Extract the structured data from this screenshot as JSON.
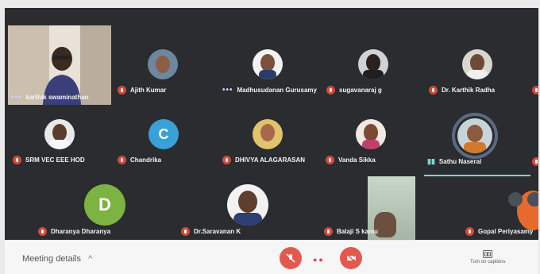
{
  "participants": [
    {
      "name": "karthik swaminathan",
      "row": 1
    },
    {
      "name": "Ajith Kumar",
      "row": 1
    },
    {
      "name": "Madhusudanan Gurusamy",
      "row": 1
    },
    {
      "name": "sugavanaraj g",
      "row": 1
    },
    {
      "name": "Dr. Karthik Radha",
      "row": 1
    },
    {
      "name": "SRM VEC EEE HOD",
      "row": 2
    },
    {
      "name": "Chandrika",
      "row": 2
    },
    {
      "name": "DHIVYA ALAGARASAN",
      "row": 2
    },
    {
      "name": "Vanda Sikka",
      "row": 2
    },
    {
      "name": "Sathu Naseral",
      "row": 2
    },
    {
      "name": "Dharanya Dharanya",
      "row": 3
    },
    {
      "name": "Dr.Saravanan K",
      "row": 3
    },
    {
      "name": "Balaji S kamu",
      "row": 3
    },
    {
      "name": "Gopal Periyasamy",
      "row": 3
    }
  ],
  "avatars": {
    "c_letter": "C",
    "d_letter": "D",
    "c_color": "#3aa1d8",
    "d_color": "#7cb342"
  },
  "bottom_bar": {
    "meeting_details": "Meeting details",
    "turn_on_captions": "Turn on captions"
  },
  "colors": {
    "mic_off": "#d34a3a",
    "end_controls": "#e25a4f",
    "highlight": "#7bd6d0"
  }
}
